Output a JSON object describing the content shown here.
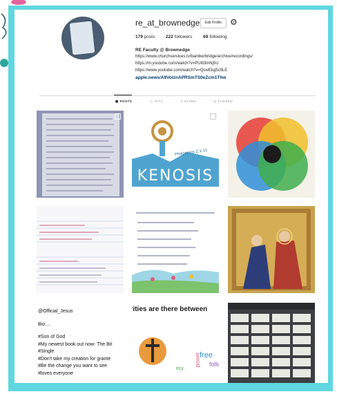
{
  "profile": {
    "username": "re_at_brownedge",
    "edit_label": "Edit Profile",
    "posts_count": "179",
    "posts_label": "posts",
    "followers_count": "222",
    "followers_label": "followers",
    "following_count": "69",
    "following_label": "following",
    "bio_name": "RE Faculty @ Brownedge",
    "bio_lines": [
      "https://www.churchservices.tv/bamberbridge/archive/recordings/",
      "https://m.youtube.com/watch?v=PUtll3mNj5U",
      "https://www.youtube.com/watch?v=QcwEkg5c9LE"
    ],
    "bio_link": "apple.news/A9VolznAPRSmTS0eZcm1Thw"
  },
  "tabs": [
    "POSTS",
    "IGTV",
    "SAVED",
    "TAGGED"
  ],
  "grid": {
    "kenosis_title": "KENOSIS",
    "kenosis_ref": "Philippians 2:1-11",
    "tweet_lines": [
      "@Official_Jesus",
      "Bio....",
      "#Son of God",
      "#My newest book out now- The Bit",
      "#Single",
      "#Don't take my creation for grante",
      "#Be the change you want to see",
      "#loves everyone"
    ],
    "wordcloud_title": "arities are there between",
    "wordcloud_words": [
      "free",
      "follo",
      "power",
      "ecy"
    ]
  },
  "colors": {
    "frame": "#5fd7e0",
    "link": "#00376b",
    "venn": [
      "#e8473f",
      "#f0bf2c",
      "#2f8fd8",
      "#3fae4c"
    ]
  }
}
